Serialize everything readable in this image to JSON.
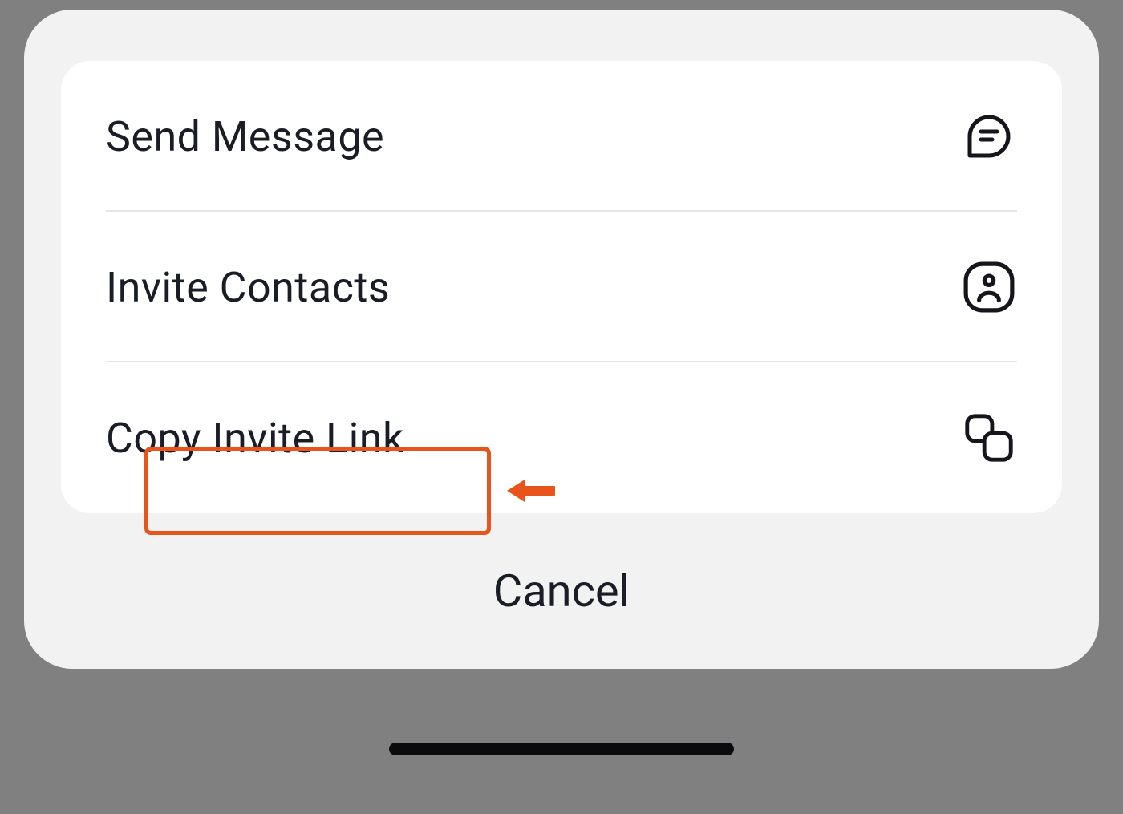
{
  "sheet": {
    "options": [
      {
        "label": "Send Message",
        "icon": "chat-icon"
      },
      {
        "label": "Invite Contacts",
        "icon": "person-icon"
      },
      {
        "label": "Copy Invite Link",
        "icon": "copy-icon"
      }
    ],
    "cancel_label": "Cancel"
  },
  "annotation": {
    "highlight_option_index": 2
  },
  "colors": {
    "highlight": "#e8541a",
    "text": "#1a1c26",
    "sheet_bg": "#f2f2f2",
    "card_bg": "#ffffff",
    "page_bg": "#808080"
  }
}
